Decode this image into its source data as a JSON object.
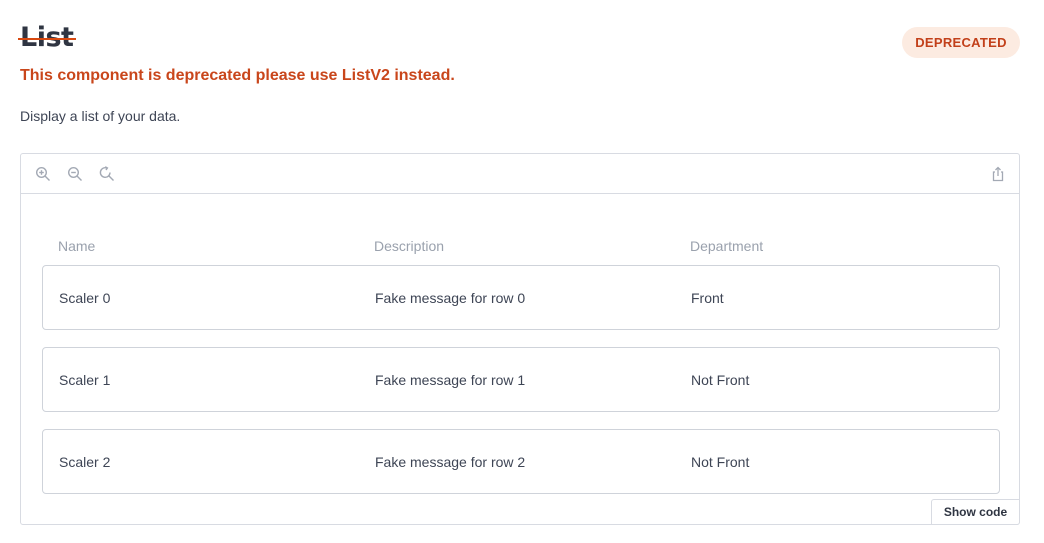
{
  "header": {
    "title": "List",
    "badge": "DEPRECATED",
    "warning": "This component is deprecated please use ListV2 instead.",
    "description": "Display a list of your data."
  },
  "toolbar": {
    "icons": [
      "zoom-in-icon",
      "zoom-out-icon",
      "reset-zoom-icon",
      "share-icon"
    ]
  },
  "list": {
    "columns": [
      "Name",
      "Description",
      "Department"
    ],
    "rows": [
      {
        "name": "Scaler 0",
        "description": "Fake message for row 0",
        "department": "Front"
      },
      {
        "name": "Scaler 1",
        "description": "Fake message for row 1",
        "department": "Not Front"
      },
      {
        "name": "Scaler 2",
        "description": "Fake message for row 2",
        "department": "Not Front"
      }
    ]
  },
  "footer": {
    "show_code_label": "Show code"
  },
  "colors": {
    "deprecated_accent": "#c9461b",
    "badge_background": "#fcebe1",
    "border": "#d8dbe2"
  }
}
